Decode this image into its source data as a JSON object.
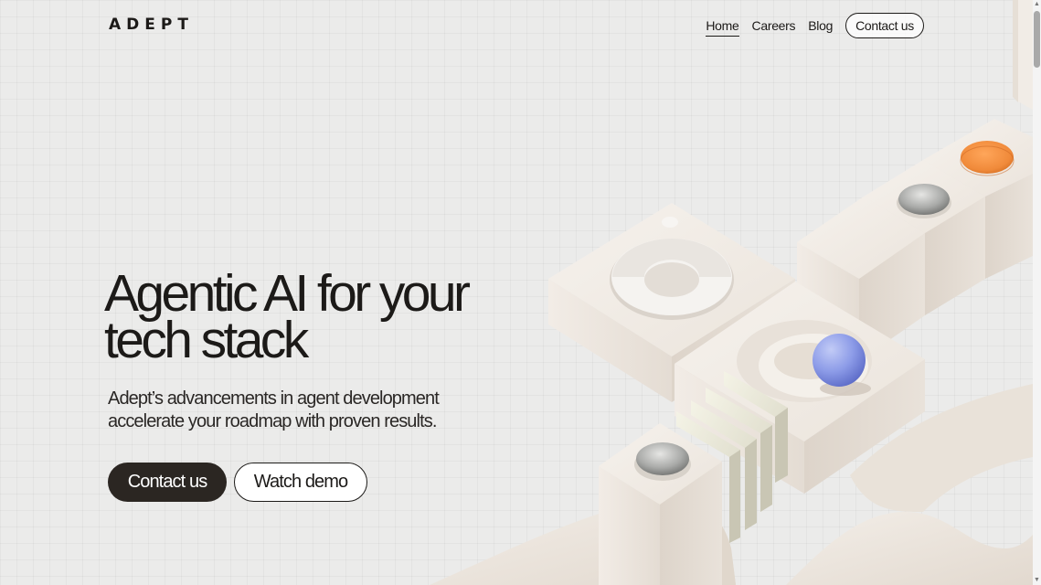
{
  "header": {
    "logo": "ADEPT",
    "nav": [
      {
        "label": "Home",
        "active": true
      },
      {
        "label": "Careers",
        "active": false
      },
      {
        "label": "Blog",
        "active": false
      }
    ],
    "contact_label": "Contact us"
  },
  "hero": {
    "title_line1": "Agentic AI for your",
    "title_line2": "tech stack",
    "subtitle_line1": "Adept’s advancements in agent development",
    "subtitle_line2": "accelerate your roadmap with proven results.",
    "primary_cta": "Contact us",
    "secondary_cta": "Watch demo"
  },
  "illustration": {
    "accent_orange": "#f08a3a",
    "accent_blue": "#8d9ce8",
    "block_color": "#efe9e2",
    "icons": [
      "orange-disc-icon",
      "steel-disc-icon",
      "blue-sphere-icon",
      "ring-dial-icon",
      "glass-panels-icon"
    ]
  },
  "scrollbar": {
    "up_glyph": "▲",
    "down_glyph": "▼"
  }
}
